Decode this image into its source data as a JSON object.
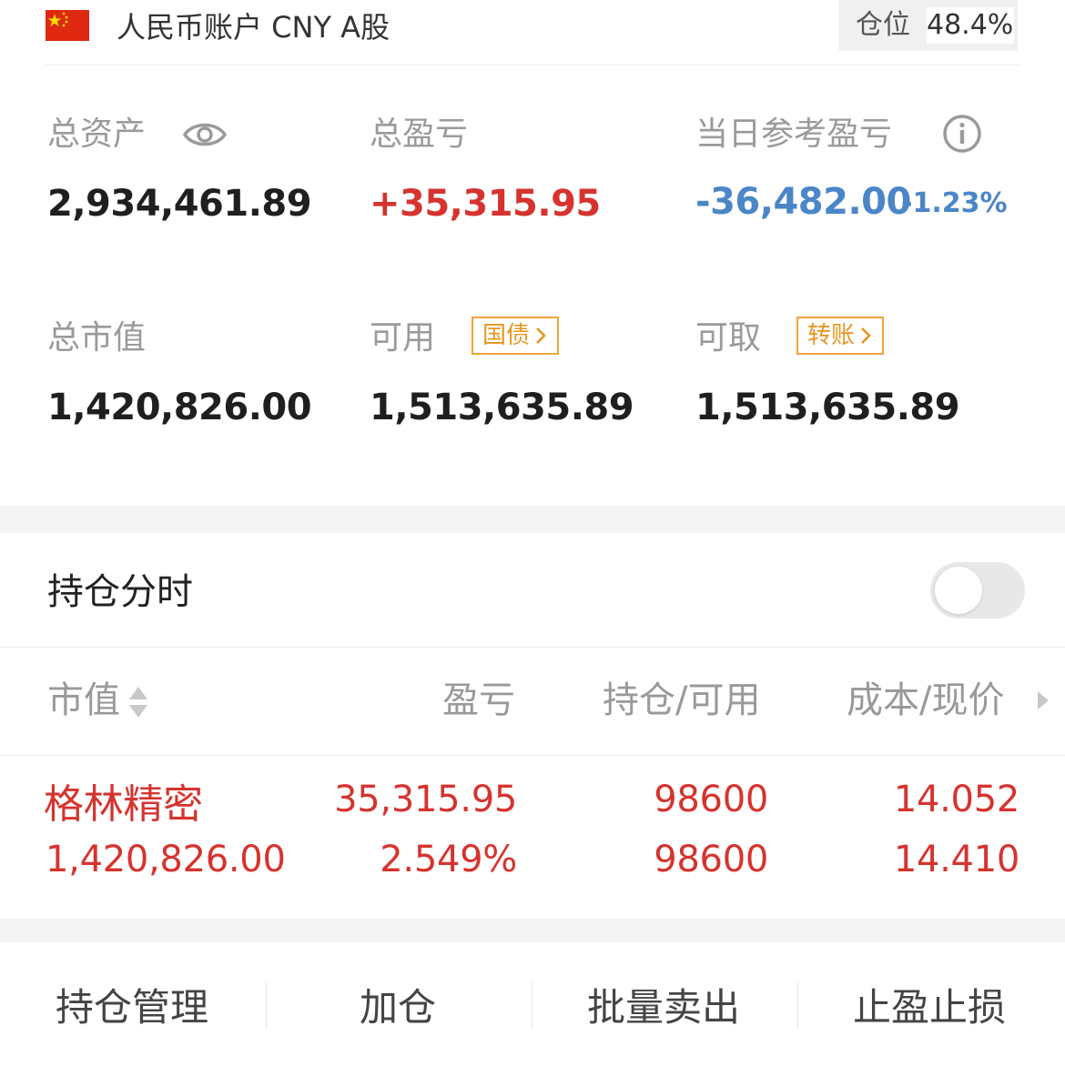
{
  "header": {
    "account_title": "人民币账户 CNY A股",
    "position_label": "仓位",
    "position_value": "48.4%"
  },
  "summary": {
    "total_assets_label": "总资产",
    "total_assets_value": "2,934,461.89",
    "total_pnl_label": "总盈亏",
    "total_pnl_value": "+35,315.95",
    "daily_pnl_label": "当日参考盈亏",
    "daily_pnl_value": "-36,482.00",
    "daily_pnl_pct": "-1.23%",
    "market_value_label": "总市值",
    "market_value_value": "1,420,826.00",
    "available_label": "可用",
    "available_tag": "国债",
    "available_value": "1,513,635.89",
    "withdrawable_label": "可取",
    "withdrawable_tag": "转账",
    "withdrawable_value": "1,513,635.89"
  },
  "timeshare": {
    "title": "持仓分时",
    "enabled": false
  },
  "table": {
    "headers": [
      "市值",
      "盈亏",
      "持仓/可用",
      "成本/现价"
    ],
    "rows": [
      {
        "name": "格林精密",
        "market_value": "1,420,826.00",
        "pnl": "35,315.95",
        "pnl_pct": "2.549%",
        "position": "98600",
        "available": "98600",
        "cost": "14.052",
        "price": "14.410"
      }
    ]
  },
  "actions": [
    "持仓管理",
    "加仓",
    "批量卖出",
    "止盈止损"
  ],
  "colors": {
    "rise": "#d6332e",
    "fall": "#4a86c8",
    "tag": "#e8951f",
    "flag": "#de2910"
  },
  "icons": [
    "china-flag-icon",
    "eye-icon",
    "info-icon",
    "chevron-right-icon",
    "sort-icon",
    "more-arrow-icon"
  ]
}
